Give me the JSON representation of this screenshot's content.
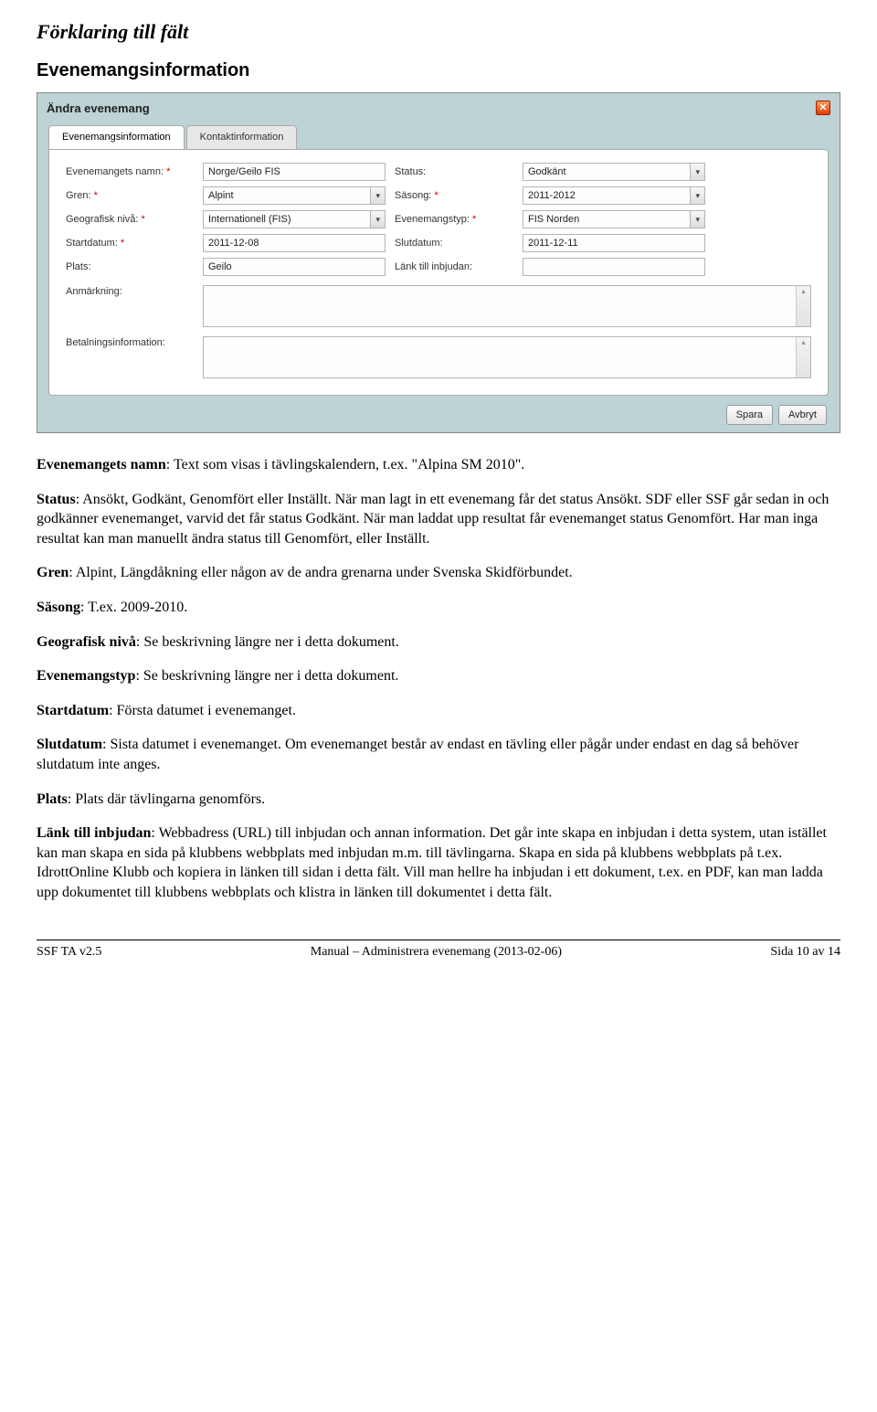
{
  "heading_italic": "Förklaring till fält",
  "heading_section": "Evenemangsinformation",
  "modal": {
    "title": "Ändra evenemang",
    "close_glyph": "✕",
    "tabs": {
      "active": "Evenemangsinformation",
      "inactive": "Kontaktinformation"
    },
    "labels": {
      "name": "Evenemangets namn:",
      "status": "Status:",
      "gren": "Gren:",
      "season": "Säsong:",
      "geo": "Geografisk nivå:",
      "etype": "Evenemangstyp:",
      "start": "Startdatum:",
      "end": "Slutdatum:",
      "place": "Plats:",
      "link": "Länk till inbjudan:",
      "note": "Anmärkning:",
      "payinfo": "Betalningsinformation:"
    },
    "req_mark": "*",
    "values": {
      "name": "Norge/Geilo FIS",
      "status": "Godkänt",
      "gren": "Alpint",
      "season": "2011-2012",
      "geo": "Internationell (FIS)",
      "etype": "FIS Norden",
      "start": "2011-12-08",
      "end": "2011-12-11",
      "place": "Geilo",
      "link": ""
    },
    "buttons": {
      "save": "Spara",
      "cancel": "Avbryt"
    }
  },
  "paragraphs": {
    "p1_lead": "Evenemangets namn",
    "p1_rest": ": Text som visas i tävlingskalendern, t.ex. \"Alpina SM 2010\".",
    "p2_lead": "Status",
    "p2_rest": ": Ansökt, Godkänt, Genomfört eller Inställt. När man lagt in ett evenemang får det status Ansökt. SDF eller SSF går sedan in och godkänner evenemanget, varvid det får status Godkänt. När man laddat upp resultat får evenemanget status Genomfört. Har man inga resultat kan man manuellt ändra status till Genomfört, eller Inställt.",
    "p3_lead": "Gren",
    "p3_rest": ": Alpint, Längdåkning eller någon av de andra grenarna under Svenska Skidförbundet.",
    "p4_lead": "Säsong",
    "p4_rest": ": T.ex. 2009-2010.",
    "p5_lead": "Geografisk nivå",
    "p5_rest": ": Se beskrivning längre ner i detta dokument.",
    "p6_lead": "Evenemangstyp",
    "p6_rest": ": Se beskrivning längre ner i detta dokument.",
    "p7_lead": "Startdatum",
    "p7_rest": ": Första datumet i evenemanget.",
    "p8_lead": "Slutdatum",
    "p8_rest": ": Sista datumet i evenemanget. Om evenemanget består av endast en tävling eller pågår under endast en dag så behöver slutdatum inte anges.",
    "p9_lead": "Plats",
    "p9_rest": ": Plats där tävlingarna genomförs.",
    "p10_lead": "Länk till inbjudan",
    "p10_rest": ": Webbadress (URL) till inbjudan och annan information. Det går inte skapa en inbjudan i detta system, utan istället kan man skapa en sida på klubbens webbplats med inbjudan m.m. till tävlingarna. Skapa en sida på klubbens webbplats på t.ex. IdrottOnline Klubb och kopiera in länken till sidan i detta fält. Vill man hellre ha inbjudan i ett dokument, t.ex. en PDF, kan man ladda upp dokumentet till klubbens webbplats och klistra in länken till dokumentet i detta fält."
  },
  "footer": {
    "left": "SSF TA v2.5",
    "center": "Manual – Administrera evenemang (2013-02-06)",
    "right": "Sida 10 av 14"
  }
}
